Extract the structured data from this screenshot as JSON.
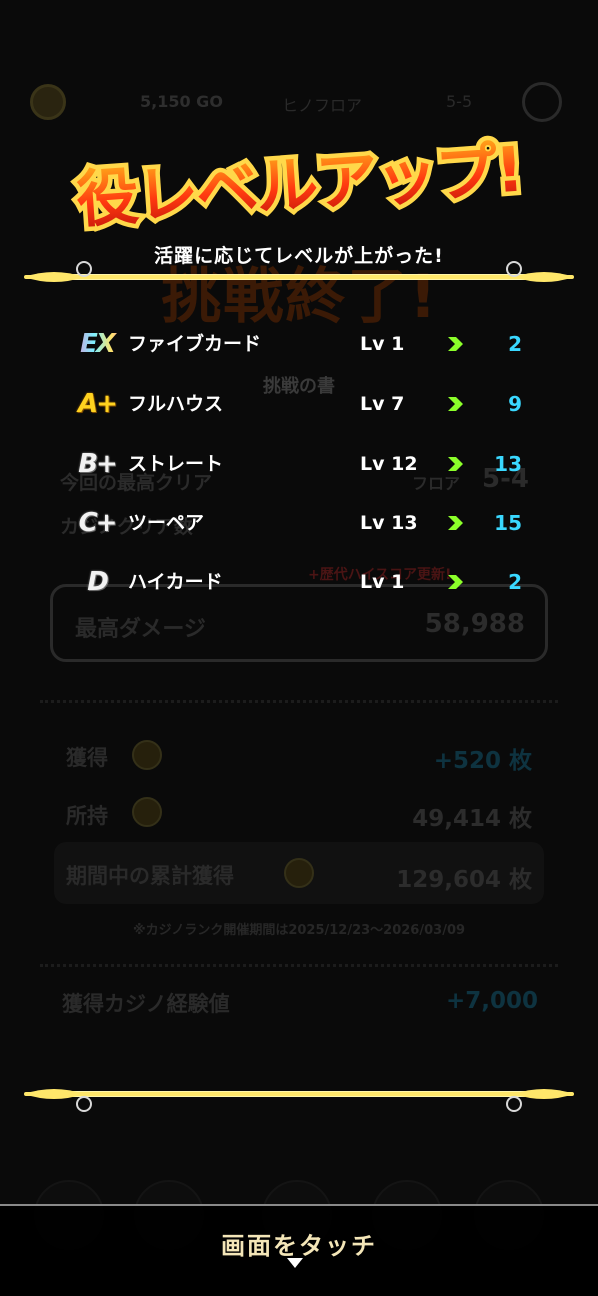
{
  "background": {
    "gold": "5,150 GO",
    "floor_label": "ヒノフロア",
    "stage": "5-5",
    "banner": "挑戦終了!",
    "book_title": "挑戦の書",
    "best_clear_label": "今回の最高クリア",
    "best_clear_floor_label": "フロア",
    "best_clear_value": "5-4",
    "cleared_count_label": "カジノクリア数",
    "high_score_note": "+歴代ハイスコア更新!",
    "max_damage_label": "最高ダメージ",
    "max_damage_value": "58,988",
    "earned_label": "獲得",
    "earned_value": "+520 枚",
    "owned_label": "所持",
    "owned_value": "49,414 枚",
    "cumulative_label": "期間中の累計獲得",
    "cumulative_value": "129,604 枚",
    "period_note": "※カジノランク開催期間は2025/12/23〜2026/03/09",
    "exp_label": "獲得カジノ経験値",
    "exp_value": "+7,000"
  },
  "overlay": {
    "title": "役レベルアップ!",
    "subtitle": "活躍に応じてレベルが上がった!",
    "rows": [
      {
        "rank": "EX",
        "hand": "ファイブカード",
        "old_lv": "Lv 1",
        "new_lv": "2"
      },
      {
        "rank": "A+",
        "hand": "フルハウス",
        "old_lv": "Lv 7",
        "new_lv": "9"
      },
      {
        "rank": "B+",
        "hand": "ストレート",
        "old_lv": "Lv 12",
        "new_lv": "13"
      },
      {
        "rank": "C+",
        "hand": "ツーペア",
        "old_lv": "Lv 13",
        "new_lv": "15"
      },
      {
        "rank": "D",
        "hand": "ハイカード",
        "old_lv": "Lv 1",
        "new_lv": "2"
      }
    ],
    "touch_label": "画面をタッチ"
  },
  "colors": {
    "new_level": "#3ad8ff",
    "arrow": "#8cff2a",
    "title_fill": "#ff3a10",
    "title_outline": "#ffd84a",
    "bar_gold": "#ffe76a"
  }
}
